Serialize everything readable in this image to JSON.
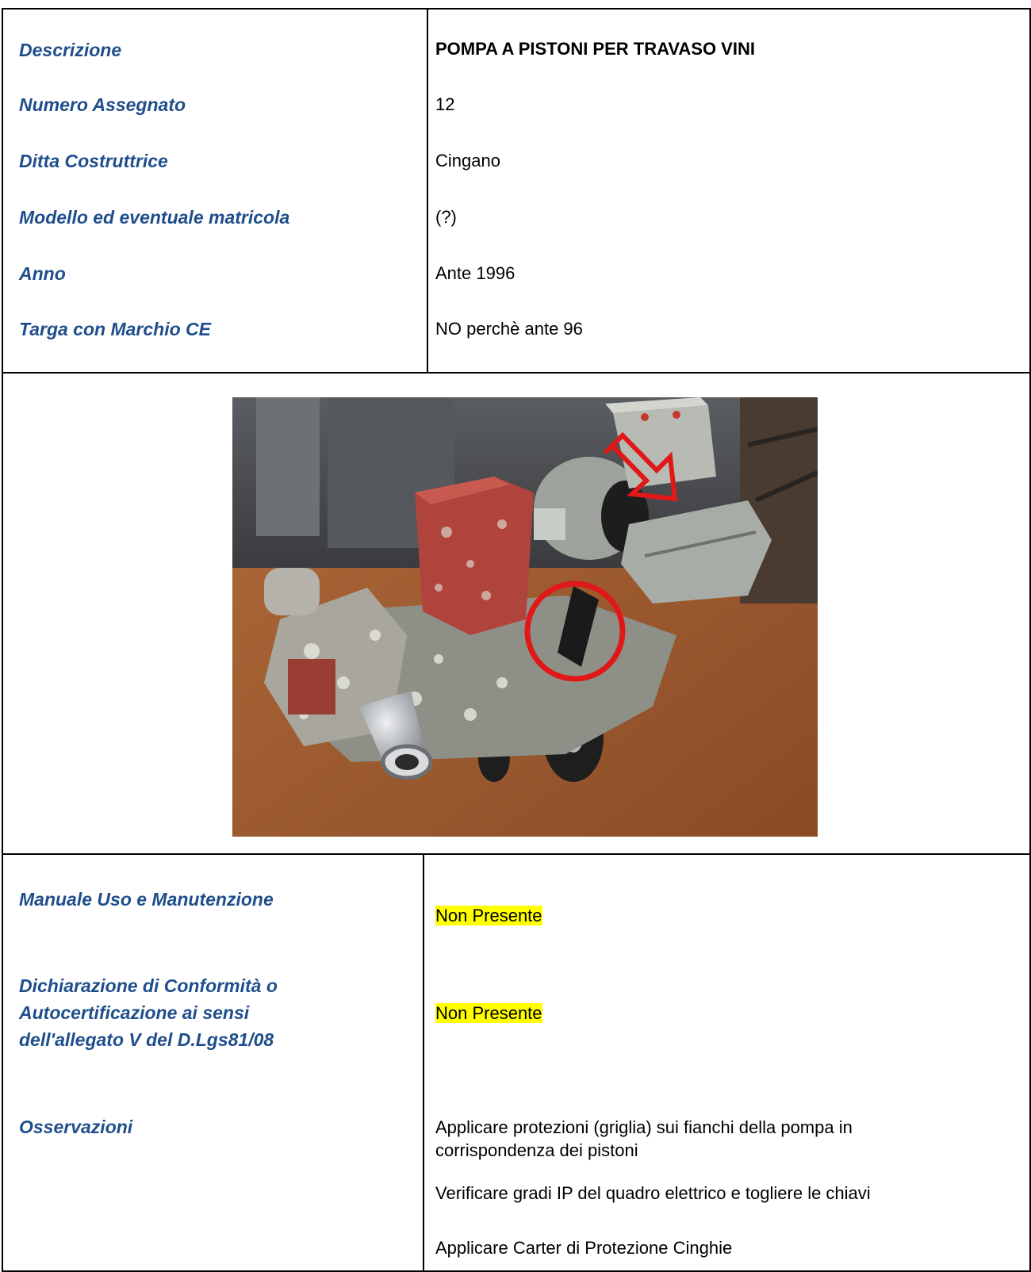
{
  "rows_top": [
    {
      "label": "Descrizione",
      "value": "POMPA  A PISTONI PER TRAVASO VINI"
    },
    {
      "label": "Numero Assegnato",
      "value": "12"
    },
    {
      "label": "Ditta Costruttrice",
      "value": "Cingano"
    },
    {
      "label": "Modello ed eventuale matricola",
      "value": "(?)"
    },
    {
      "label": "Anno",
      "value": "Ante 1996"
    },
    {
      "label": "Targa con Marchio CE",
      "value": "NO perchè ante 96"
    }
  ],
  "bottom": {
    "manuale_label": "Manuale Uso e Manutenzione",
    "manuale_value": "Non Presente",
    "dichiarazione_label": [
      "Dichiarazione di Conformità o",
      "Autocertificazione ai sensi",
      "dell'allegato V del D.Lgs81/08"
    ],
    "dichiarazione_value": "Non Presente",
    "osservazioni_label": "Osservazioni",
    "osservazioni": [
      [
        "Applicare protezioni (griglia) sui fianchi della pompa in",
        "corrispondenza dei pistoni"
      ],
      [
        "Verificare gradi IP del quadro elettrico e togliere le chiavi"
      ],
      [
        "Applicare Carter di Protezione Cinghie"
      ]
    ]
  },
  "colors": {
    "label": "#1f4e8c",
    "highlight": "#ffff00",
    "annotation": "#e01818"
  }
}
